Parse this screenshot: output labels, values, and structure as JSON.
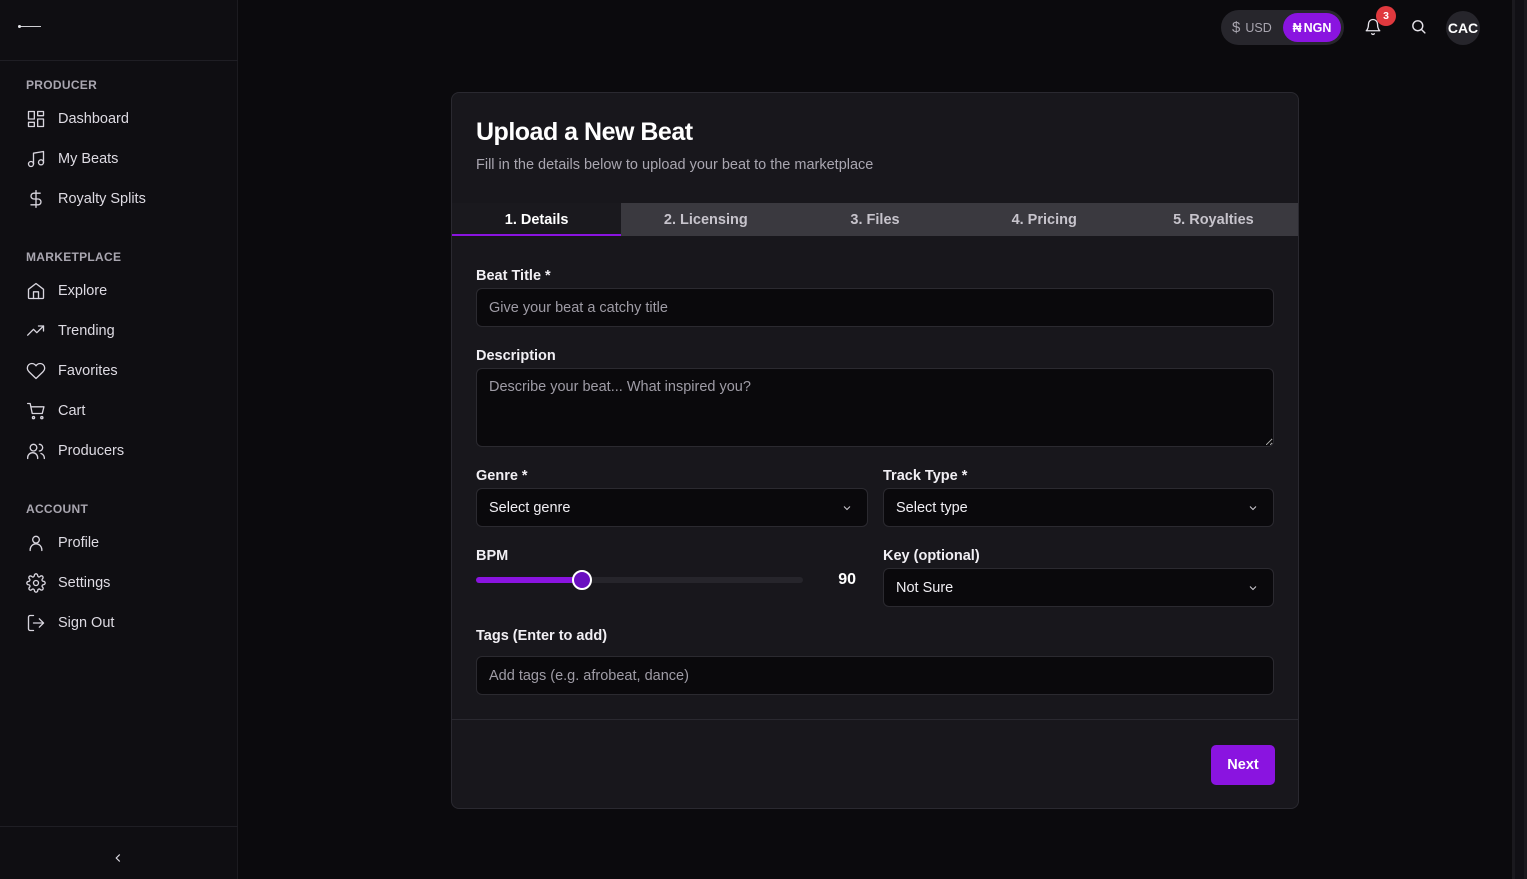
{
  "sidebar": {
    "sections": [
      {
        "title": "PRODUCER",
        "items": [
          {
            "label": "Dashboard",
            "icon": "dashboard-icon"
          },
          {
            "label": "My Beats",
            "icon": "music-note-icon"
          },
          {
            "label": "Royalty Splits",
            "icon": "dollar-icon"
          }
        ]
      },
      {
        "title": "MARKETPLACE",
        "items": [
          {
            "label": "Explore",
            "icon": "home-icon"
          },
          {
            "label": "Trending",
            "icon": "trending-up-icon"
          },
          {
            "label": "Favorites",
            "icon": "heart-icon"
          },
          {
            "label": "Cart",
            "icon": "cart-icon"
          },
          {
            "label": "Producers",
            "icon": "users-icon"
          }
        ]
      },
      {
        "title": "ACCOUNT",
        "items": [
          {
            "label": "Profile",
            "icon": "user-icon"
          },
          {
            "label": "Settings",
            "icon": "gear-icon"
          },
          {
            "label": "Sign Out",
            "icon": "sign-out-icon"
          }
        ]
      }
    ]
  },
  "topbar": {
    "currency": {
      "usd_symbol": "$",
      "usd_label": "USD",
      "ngn_symbol": "₦",
      "ngn_label": "NGN",
      "selected": "NGN"
    },
    "notifications_count": "3",
    "avatar_initials": "CAC"
  },
  "card": {
    "title": "Upload a New Beat",
    "subtitle": "Fill in the details below to upload your beat to the marketplace",
    "tabs": [
      "1. Details",
      "2. Licensing",
      "3. Files",
      "4. Pricing",
      "5. Royalties"
    ],
    "active_tab": 0,
    "form": {
      "title_label": "Beat Title *",
      "title_placeholder": "Give your beat a catchy title",
      "description_label": "Description",
      "description_placeholder": "Describe your beat... What inspired you?",
      "genre_label": "Genre *",
      "genre_value": "Select genre",
      "track_type_label": "Track Type *",
      "track_type_value": "Select type",
      "bpm_label": "BPM",
      "bpm_value": "90",
      "bpm_fraction": 0.325,
      "key_label": "Key (optional)",
      "key_value": "Not Sure",
      "tags_label": "Tags (Enter to add)",
      "tags_placeholder": "Add tags (e.g. afrobeat, dance)"
    },
    "next_label": "Next"
  },
  "colors": {
    "accent": "#8a14e0",
    "badge": "#e0393e",
    "background": "#0b0a0d",
    "card": "#18171c"
  }
}
